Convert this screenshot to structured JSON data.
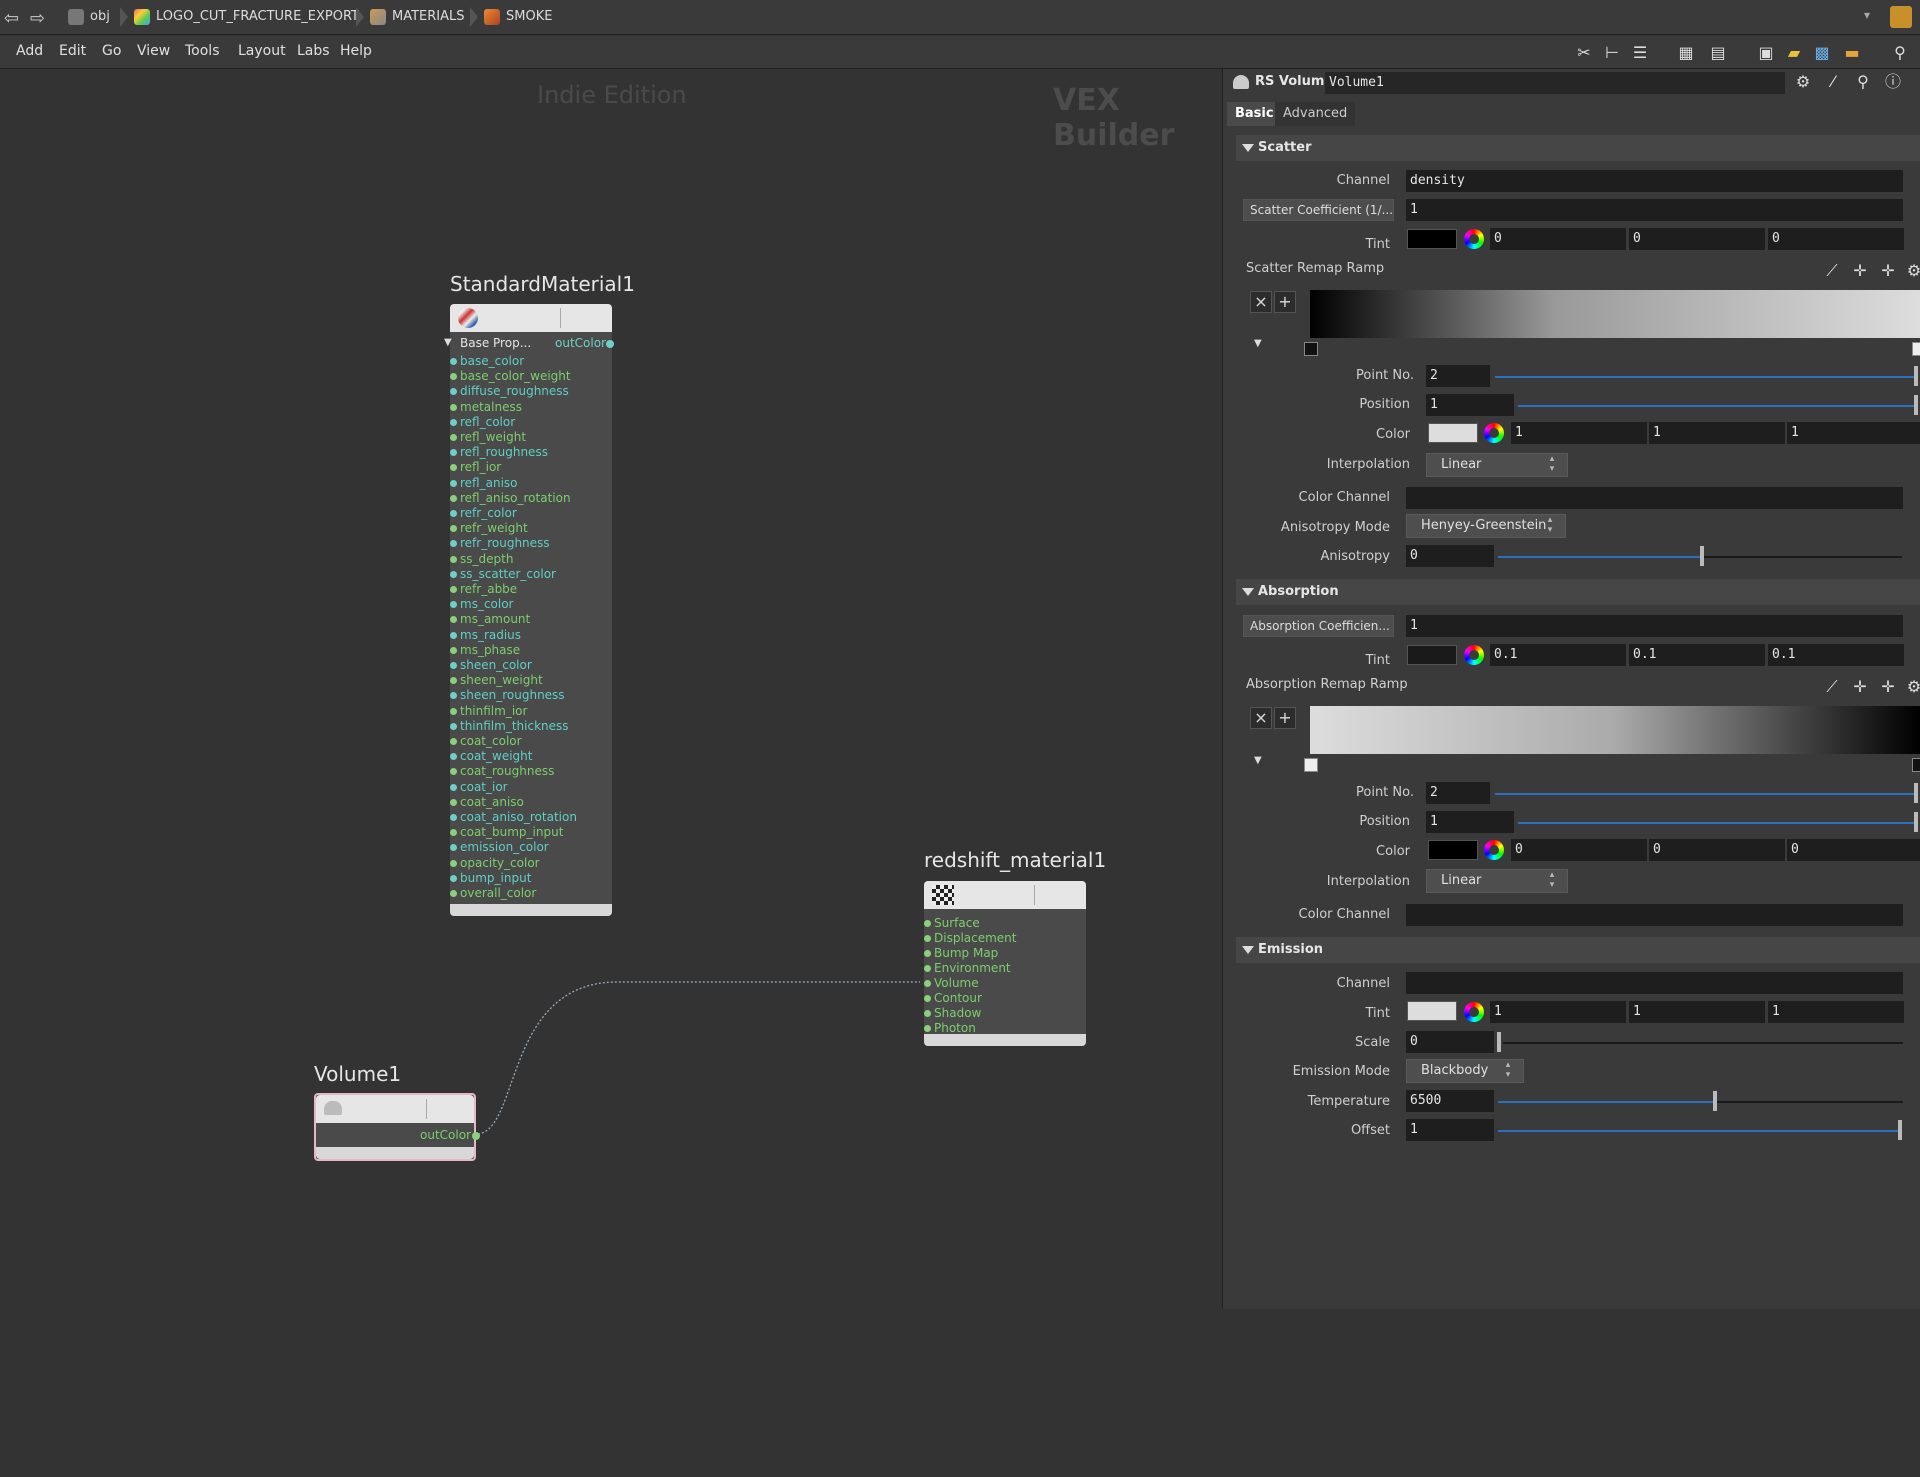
{
  "pathbar": {
    "crumbs": [
      "obj",
      "LOGO_CUT_FRACTURE_EXPORT",
      "MATERIALS",
      "SMOKE"
    ]
  },
  "menubar": {
    "items": [
      "Add",
      "Edit",
      "Go",
      "View",
      "Tools",
      "Layout",
      "Labs",
      "Help"
    ]
  },
  "network": {
    "watermark_edition": "Indie Edition",
    "watermark_context": "VEX Builder",
    "nodes": {
      "standard": {
        "name": "StandardMaterial1",
        "group_label": "Base Prop...",
        "output": "outColor",
        "inputs": [
          "base_color",
          "base_color_weight",
          "diffuse_roughness",
          "metalness",
          "refl_color",
          "refl_weight",
          "refl_roughness",
          "refl_ior",
          "refl_aniso",
          "refl_aniso_rotation",
          "refr_color",
          "refr_weight",
          "refr_roughness",
          "ss_depth",
          "ss_scatter_color",
          "refr_abbe",
          "ms_color",
          "ms_amount",
          "ms_radius",
          "ms_phase",
          "sheen_color",
          "sheen_weight",
          "sheen_roughness",
          "thinfilm_ior",
          "thinfilm_thickness",
          "coat_color",
          "coat_weight",
          "coat_roughness",
          "coat_ior",
          "coat_aniso",
          "coat_aniso_rotation",
          "coat_bump_input",
          "emission_color",
          "opacity_color",
          "bump_input",
          "overall_color"
        ]
      },
      "redshift": {
        "name": "redshift_material1",
        "inputs": [
          "Surface",
          "Displacement",
          "Bump Map",
          "Environment",
          "Volume",
          "Contour",
          "Shadow",
          "Photon"
        ]
      },
      "volume": {
        "name": "Volume1",
        "output": "outColor"
      }
    }
  },
  "params": {
    "node_type": "RS Volume",
    "node_name": "Volume1",
    "tabs": [
      "Basic",
      "Advanced"
    ],
    "scatter": {
      "title": "Scatter",
      "channel_label": "Channel",
      "channel_value": "density",
      "coef_label": "Scatter Coefficient (1/...",
      "coef_value": "1",
      "tint_label": "Tint",
      "tint": [
        "0",
        "0",
        "0"
      ],
      "ramp_label": "Scatter Remap Ramp",
      "point_label": "Point No.",
      "point_value": "2",
      "position_label": "Position",
      "position_value": "1",
      "color_label": "Color",
      "color": [
        "1",
        "1",
        "1"
      ],
      "interp_label": "Interpolation",
      "interp_value": "Linear",
      "color_channel_label": "Color Channel",
      "aniso_mode_label": "Anisotropy Mode",
      "aniso_mode_value": "Henyey-Greenstein",
      "aniso_label": "Anisotropy",
      "aniso_value": "0",
      "aniso_fraction": 0.5
    },
    "absorption": {
      "title": "Absorption",
      "coef_label": "Absorption Coefficien...",
      "coef_value": "1",
      "tint_label": "Tint",
      "tint": [
        "0.1",
        "0.1",
        "0.1"
      ],
      "ramp_label": "Absorption Remap Ramp",
      "point_label": "Point No.",
      "point_value": "2",
      "position_label": "Position",
      "position_value": "1",
      "color_label": "Color",
      "color": [
        "0",
        "0",
        "0"
      ],
      "interp_label": "Interpolation",
      "interp_value": "Linear",
      "color_channel_label": "Color Channel"
    },
    "emission": {
      "title": "Emission",
      "channel_label": "Channel",
      "tint_label": "Tint",
      "tint": [
        "1",
        "1",
        "1"
      ],
      "scale_label": "Scale",
      "scale_value": "0",
      "mode_label": "Emission Mode",
      "mode_value": "Blackbody",
      "temp_label": "Temperature",
      "temp_value": "6500",
      "offset_label": "Offset",
      "offset_value": "1"
    }
  },
  "colors": {
    "port_teal": "#6fd0c6",
    "port_green": "#8bd07c",
    "slider_blue": "#2b6fbf"
  }
}
